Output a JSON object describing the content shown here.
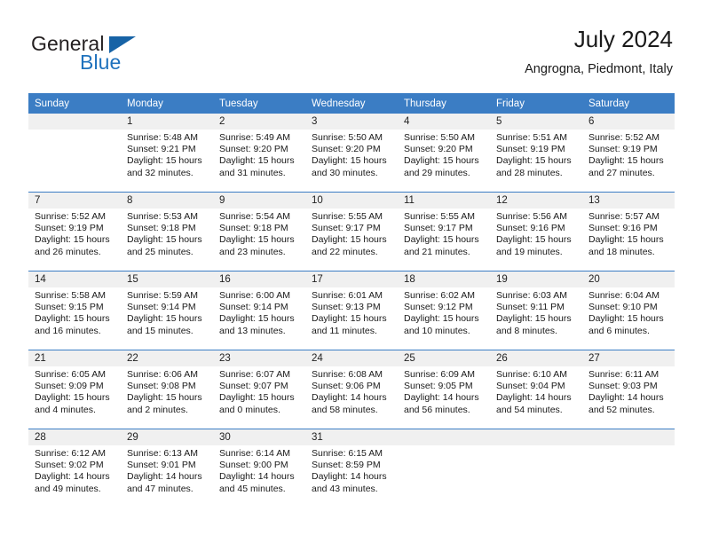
{
  "brand": {
    "name_top": "General",
    "name_bottom": "Blue",
    "accent_color": "#1f72bd",
    "triangle_color": "#1763a6"
  },
  "header": {
    "title": "July 2024",
    "subtitle": "Angrogna, Piedmont, Italy"
  },
  "theme": {
    "header_bg": "#3b7dc4",
    "header_text": "#ffffff",
    "daynum_bg": "#f0f0f0",
    "separator": "#3b7dc4"
  },
  "weekdays": [
    "Sunday",
    "Monday",
    "Tuesday",
    "Wednesday",
    "Thursday",
    "Friday",
    "Saturday"
  ],
  "weeks": [
    [
      {
        "day": "",
        "sunrise": "",
        "sunset": "",
        "daylight1": "",
        "daylight2": ""
      },
      {
        "day": "1",
        "sunrise": "Sunrise: 5:48 AM",
        "sunset": "Sunset: 9:21 PM",
        "daylight1": "Daylight: 15 hours",
        "daylight2": "and 32 minutes."
      },
      {
        "day": "2",
        "sunrise": "Sunrise: 5:49 AM",
        "sunset": "Sunset: 9:20 PM",
        "daylight1": "Daylight: 15 hours",
        "daylight2": "and 31 minutes."
      },
      {
        "day": "3",
        "sunrise": "Sunrise: 5:50 AM",
        "sunset": "Sunset: 9:20 PM",
        "daylight1": "Daylight: 15 hours",
        "daylight2": "and 30 minutes."
      },
      {
        "day": "4",
        "sunrise": "Sunrise: 5:50 AM",
        "sunset": "Sunset: 9:20 PM",
        "daylight1": "Daylight: 15 hours",
        "daylight2": "and 29 minutes."
      },
      {
        "day": "5",
        "sunrise": "Sunrise: 5:51 AM",
        "sunset": "Sunset: 9:19 PM",
        "daylight1": "Daylight: 15 hours",
        "daylight2": "and 28 minutes."
      },
      {
        "day": "6",
        "sunrise": "Sunrise: 5:52 AM",
        "sunset": "Sunset: 9:19 PM",
        "daylight1": "Daylight: 15 hours",
        "daylight2": "and 27 minutes."
      }
    ],
    [
      {
        "day": "7",
        "sunrise": "Sunrise: 5:52 AM",
        "sunset": "Sunset: 9:19 PM",
        "daylight1": "Daylight: 15 hours",
        "daylight2": "and 26 minutes."
      },
      {
        "day": "8",
        "sunrise": "Sunrise: 5:53 AM",
        "sunset": "Sunset: 9:18 PM",
        "daylight1": "Daylight: 15 hours",
        "daylight2": "and 25 minutes."
      },
      {
        "day": "9",
        "sunrise": "Sunrise: 5:54 AM",
        "sunset": "Sunset: 9:18 PM",
        "daylight1": "Daylight: 15 hours",
        "daylight2": "and 23 minutes."
      },
      {
        "day": "10",
        "sunrise": "Sunrise: 5:55 AM",
        "sunset": "Sunset: 9:17 PM",
        "daylight1": "Daylight: 15 hours",
        "daylight2": "and 22 minutes."
      },
      {
        "day": "11",
        "sunrise": "Sunrise: 5:55 AM",
        "sunset": "Sunset: 9:17 PM",
        "daylight1": "Daylight: 15 hours",
        "daylight2": "and 21 minutes."
      },
      {
        "day": "12",
        "sunrise": "Sunrise: 5:56 AM",
        "sunset": "Sunset: 9:16 PM",
        "daylight1": "Daylight: 15 hours",
        "daylight2": "and 19 minutes."
      },
      {
        "day": "13",
        "sunrise": "Sunrise: 5:57 AM",
        "sunset": "Sunset: 9:16 PM",
        "daylight1": "Daylight: 15 hours",
        "daylight2": "and 18 minutes."
      }
    ],
    [
      {
        "day": "14",
        "sunrise": "Sunrise: 5:58 AM",
        "sunset": "Sunset: 9:15 PM",
        "daylight1": "Daylight: 15 hours",
        "daylight2": "and 16 minutes."
      },
      {
        "day": "15",
        "sunrise": "Sunrise: 5:59 AM",
        "sunset": "Sunset: 9:14 PM",
        "daylight1": "Daylight: 15 hours",
        "daylight2": "and 15 minutes."
      },
      {
        "day": "16",
        "sunrise": "Sunrise: 6:00 AM",
        "sunset": "Sunset: 9:14 PM",
        "daylight1": "Daylight: 15 hours",
        "daylight2": "and 13 minutes."
      },
      {
        "day": "17",
        "sunrise": "Sunrise: 6:01 AM",
        "sunset": "Sunset: 9:13 PM",
        "daylight1": "Daylight: 15 hours",
        "daylight2": "and 11 minutes."
      },
      {
        "day": "18",
        "sunrise": "Sunrise: 6:02 AM",
        "sunset": "Sunset: 9:12 PM",
        "daylight1": "Daylight: 15 hours",
        "daylight2": "and 10 minutes."
      },
      {
        "day": "19",
        "sunrise": "Sunrise: 6:03 AM",
        "sunset": "Sunset: 9:11 PM",
        "daylight1": "Daylight: 15 hours",
        "daylight2": "and 8 minutes."
      },
      {
        "day": "20",
        "sunrise": "Sunrise: 6:04 AM",
        "sunset": "Sunset: 9:10 PM",
        "daylight1": "Daylight: 15 hours",
        "daylight2": "and 6 minutes."
      }
    ],
    [
      {
        "day": "21",
        "sunrise": "Sunrise: 6:05 AM",
        "sunset": "Sunset: 9:09 PM",
        "daylight1": "Daylight: 15 hours",
        "daylight2": "and 4 minutes."
      },
      {
        "day": "22",
        "sunrise": "Sunrise: 6:06 AM",
        "sunset": "Sunset: 9:08 PM",
        "daylight1": "Daylight: 15 hours",
        "daylight2": "and 2 minutes."
      },
      {
        "day": "23",
        "sunrise": "Sunrise: 6:07 AM",
        "sunset": "Sunset: 9:07 PM",
        "daylight1": "Daylight: 15 hours",
        "daylight2": "and 0 minutes."
      },
      {
        "day": "24",
        "sunrise": "Sunrise: 6:08 AM",
        "sunset": "Sunset: 9:06 PM",
        "daylight1": "Daylight: 14 hours",
        "daylight2": "and 58 minutes."
      },
      {
        "day": "25",
        "sunrise": "Sunrise: 6:09 AM",
        "sunset": "Sunset: 9:05 PM",
        "daylight1": "Daylight: 14 hours",
        "daylight2": "and 56 minutes."
      },
      {
        "day": "26",
        "sunrise": "Sunrise: 6:10 AM",
        "sunset": "Sunset: 9:04 PM",
        "daylight1": "Daylight: 14 hours",
        "daylight2": "and 54 minutes."
      },
      {
        "day": "27",
        "sunrise": "Sunrise: 6:11 AM",
        "sunset": "Sunset: 9:03 PM",
        "daylight1": "Daylight: 14 hours",
        "daylight2": "and 52 minutes."
      }
    ],
    [
      {
        "day": "28",
        "sunrise": "Sunrise: 6:12 AM",
        "sunset": "Sunset: 9:02 PM",
        "daylight1": "Daylight: 14 hours",
        "daylight2": "and 49 minutes."
      },
      {
        "day": "29",
        "sunrise": "Sunrise: 6:13 AM",
        "sunset": "Sunset: 9:01 PM",
        "daylight1": "Daylight: 14 hours",
        "daylight2": "and 47 minutes."
      },
      {
        "day": "30",
        "sunrise": "Sunrise: 6:14 AM",
        "sunset": "Sunset: 9:00 PM",
        "daylight1": "Daylight: 14 hours",
        "daylight2": "and 45 minutes."
      },
      {
        "day": "31",
        "sunrise": "Sunrise: 6:15 AM",
        "sunset": "Sunset: 8:59 PM",
        "daylight1": "Daylight: 14 hours",
        "daylight2": "and 43 minutes."
      },
      {
        "day": "",
        "sunrise": "",
        "sunset": "",
        "daylight1": "",
        "daylight2": ""
      },
      {
        "day": "",
        "sunrise": "",
        "sunset": "",
        "daylight1": "",
        "daylight2": ""
      },
      {
        "day": "",
        "sunrise": "",
        "sunset": "",
        "daylight1": "",
        "daylight2": ""
      }
    ]
  ]
}
